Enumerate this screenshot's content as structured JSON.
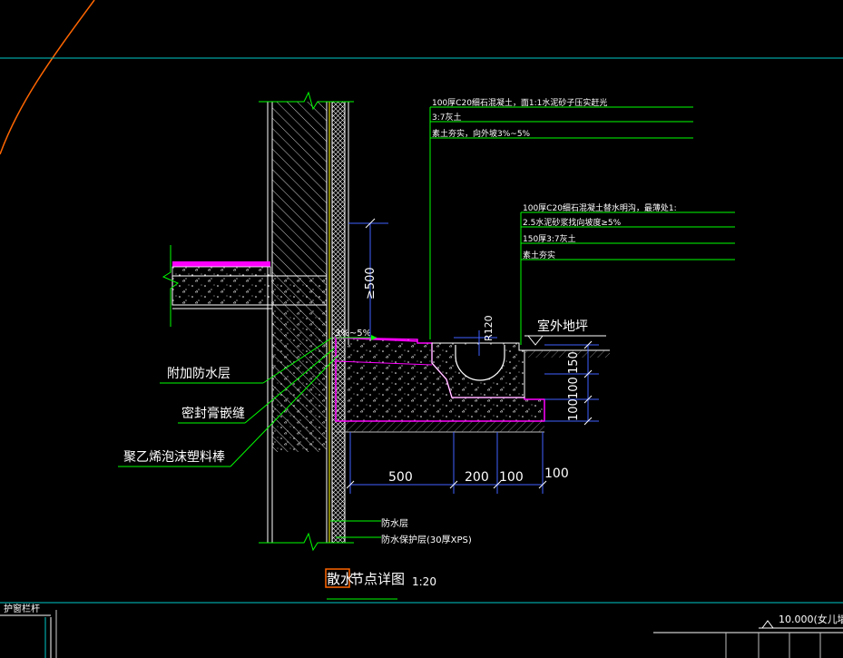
{
  "drawing": {
    "title_highlighted": "散水",
    "title_rest": "节点详图",
    "scale": "1:20"
  },
  "notes_top": {
    "line1": "100厚C20细石混凝土，面1:1水泥砂子压实赶光",
    "line2": "3:7灰土",
    "line3": "素土夯实，向外坡3%~5%"
  },
  "notes_mid": {
    "line1": "100厚C20细石混凝土替水明沟，最薄处1:",
    "line2": "2.5水泥砂浆找向坡度≥5%",
    "line3": "150厚3:7灰土",
    "line4": "素土夯实"
  },
  "labels": {
    "outdoor_ground": "室外地坪",
    "extra_waterproof": "附加防水层",
    "sealant": "密封膏嵌缝",
    "pe_foam_rod": "聚乙烯泡沫塑料棒",
    "waterproof_layer": "防水层",
    "waterproof_protect": "防水保护层(30厚XPS)",
    "slope": "3%~5%",
    "railing": "护窗栏杆",
    "elevation": "10.000(女儿墙"
  },
  "dimensions": {
    "vertical_500": "≥500",
    "drain_radius": "R120",
    "h_500": "500",
    "h_200": "200",
    "h_100a": "100",
    "h_100b": "100",
    "v_150": "150",
    "v_100a": "100",
    "v_100b": "100"
  },
  "colors": {
    "background": "#000000",
    "cyan_axis": "#00c8c8",
    "green": "#00ff00",
    "magenta": "#ff00ff",
    "blue": "#4060ff",
    "orange": "#ff6600",
    "white": "#ffffff",
    "gray": "#bbbbbb"
  }
}
